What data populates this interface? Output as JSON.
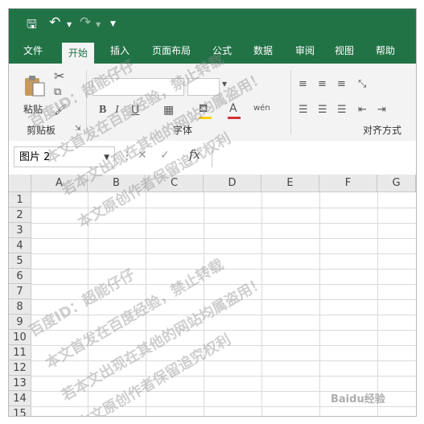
{
  "qat": {
    "save_icon": "save-icon",
    "undo_icon": "undo-icon",
    "redo_icon": "redo-icon",
    "customize_icon": "customize-qat-icon"
  },
  "tabs": [
    {
      "label": "文件"
    },
    {
      "label": "开始",
      "active": true
    },
    {
      "label": "插入"
    },
    {
      "label": "页面布局"
    },
    {
      "label": "公式"
    },
    {
      "label": "数据"
    },
    {
      "label": "审阅"
    },
    {
      "label": "视图"
    },
    {
      "label": "帮助"
    }
  ],
  "ribbon": {
    "paste_label": "粘贴",
    "clipboard_group": "剪贴板",
    "font_group": "字体",
    "alignment_group": "对齐方式",
    "bold": "B",
    "italic": "I",
    "font_color_letter": "A",
    "phonetic": "wén"
  },
  "formula_bar": {
    "name_box": "图片 2",
    "fx": "fx",
    "formula": ""
  },
  "columns": [
    "A",
    "B",
    "C",
    "D",
    "E",
    "F",
    "G"
  ],
  "rows": [
    "1",
    "2",
    "3",
    "4",
    "5",
    "6",
    "7",
    "8",
    "9",
    "10",
    "11",
    "12",
    "13",
    "14",
    "15"
  ],
  "watermark": {
    "line1": "百度ID：超能仔仔",
    "line2": "本文首发在百度经验，禁止转载",
    "line3": "若本文出现在其他的网站均属盗用！",
    "line4": "本文原创作者保留追究权利"
  },
  "logo_text": "Baidu经验",
  "colors": {
    "brand_green": "#217346",
    "ribbon_bg": "#f3f3f3",
    "font_color_bar": "#d13438",
    "fill_color_bar": "#ffd000"
  }
}
